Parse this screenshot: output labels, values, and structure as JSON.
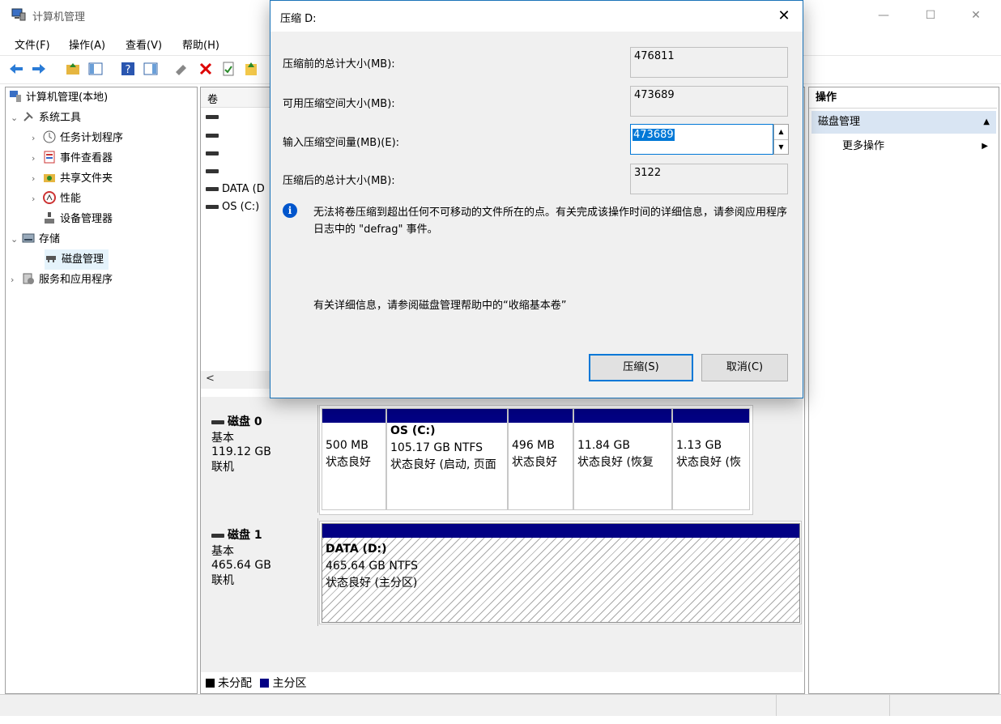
{
  "window": {
    "title": "计算机管理",
    "minimize": "—",
    "maximize": "☐",
    "close": "✕"
  },
  "menu": [
    "文件(F)",
    "操作(A)",
    "查看(V)",
    "帮助(H)"
  ],
  "tree": {
    "root": "计算机管理(本地)",
    "system_tools": "系统工具",
    "task_scheduler": "任务计划程序",
    "event_viewer": "事件查看器",
    "shared_folders": "共享文件夹",
    "performance": "性能",
    "device_manager": "设备管理器",
    "storage": "存储",
    "disk_management": "磁盘管理",
    "services": "服务和应用程序"
  },
  "volumes": {
    "header": "卷",
    "rows": [
      "",
      "",
      "",
      "",
      "DATA (D",
      "OS (C:)"
    ]
  },
  "disks": [
    {
      "name": "磁盘 0",
      "type": "基本",
      "size": "119.12 GB",
      "status": "联机",
      "partitions": [
        {
          "title": "",
          "size": "500 MB",
          "state": "状态良好"
        },
        {
          "title": "OS  (C:)",
          "size": "105.17 GB NTFS",
          "state": "状态良好 (启动, 页面"
        },
        {
          "title": "",
          "size": "496 MB",
          "state": "状态良好"
        },
        {
          "title": "",
          "size": "11.84 GB",
          "state": "状态良好 (恢复"
        },
        {
          "title": "",
          "size": "1.13 GB",
          "state": "状态良好 (恢"
        }
      ]
    },
    {
      "name": "磁盘 1",
      "type": "基本",
      "size": "465.64 GB",
      "status": "联机",
      "partitions": [
        {
          "title": "DATA  (D:)",
          "size": "465.64 GB NTFS",
          "state": "状态良好 (主分区)"
        }
      ]
    }
  ],
  "legend": {
    "unallocated": "未分配",
    "primary": "主分区",
    "colors": {
      "unallocated": "#000000",
      "primary": "#020084"
    }
  },
  "actions": {
    "header": "操作",
    "section": "磁盘管理",
    "more": "更多操作"
  },
  "dialog": {
    "title": "压缩 D:",
    "close": "✕",
    "total_before_label": "压缩前的总计大小(MB):",
    "total_before": "476811",
    "available_label": "可用压缩空间大小(MB):",
    "available": "473689",
    "input_label": "输入压缩空间量(MB)(E):",
    "input_value": "473689",
    "total_after_label": "压缩后的总计大小(MB):",
    "total_after": "3122",
    "info": "无法将卷压缩到超出任何不可移动的文件所在的点。有关完成该操作时间的详细信息，请参阅应用程序日志中的 \"defrag\" 事件。",
    "help": "有关详细信息，请参阅磁盘管理帮助中的“收缩基本卷”",
    "shrink_button": "压缩(S)",
    "cancel_button": "取消(C)"
  }
}
